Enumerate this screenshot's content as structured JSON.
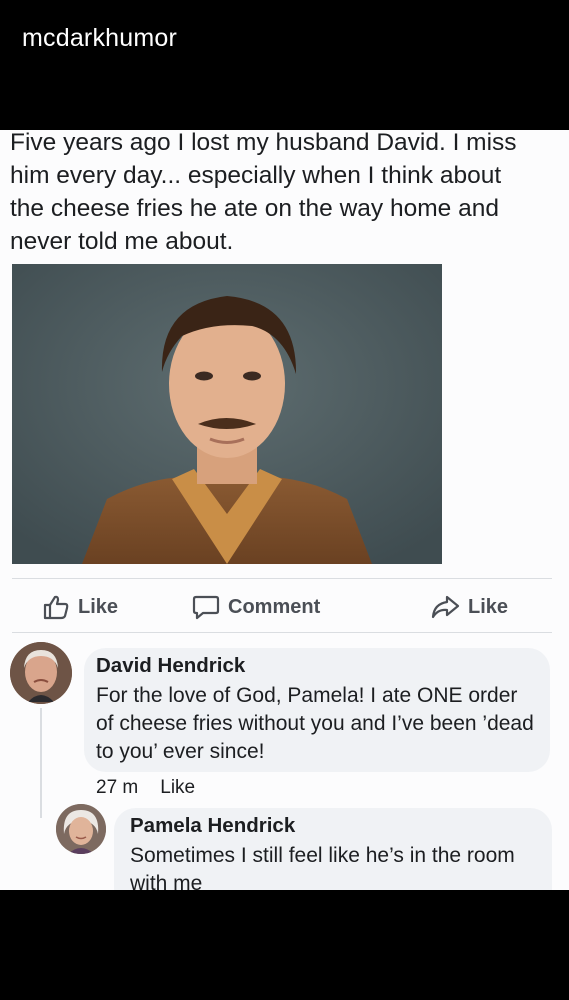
{
  "header": {
    "account_name": "mcdarkhumor"
  },
  "post": {
    "caption": "Five years ago I lost my husband David. I miss him every day... especially when I think about the cheese fries he ate on the way home and never told me about.",
    "actions": {
      "like_label": "Like",
      "comment_label": "Comment",
      "share_label": "Like"
    }
  },
  "comments": [
    {
      "author": "David Hendrick",
      "text": "For the love of God, Pamela! I ate ONE order of cheese fries without you and I’ve been ’dead to you’ ever since!",
      "time": "27 m",
      "like_label": "Like"
    },
    {
      "author": "Pamela Hendrick",
      "text": "Sometimes I still feel like he’s in the room with me"
    }
  ],
  "colors": {
    "background": "#000000",
    "post_background": "#fcfcfd",
    "bubble": "#f0f2f5",
    "text": "#1c1e21",
    "action_text": "#4b4f56"
  }
}
